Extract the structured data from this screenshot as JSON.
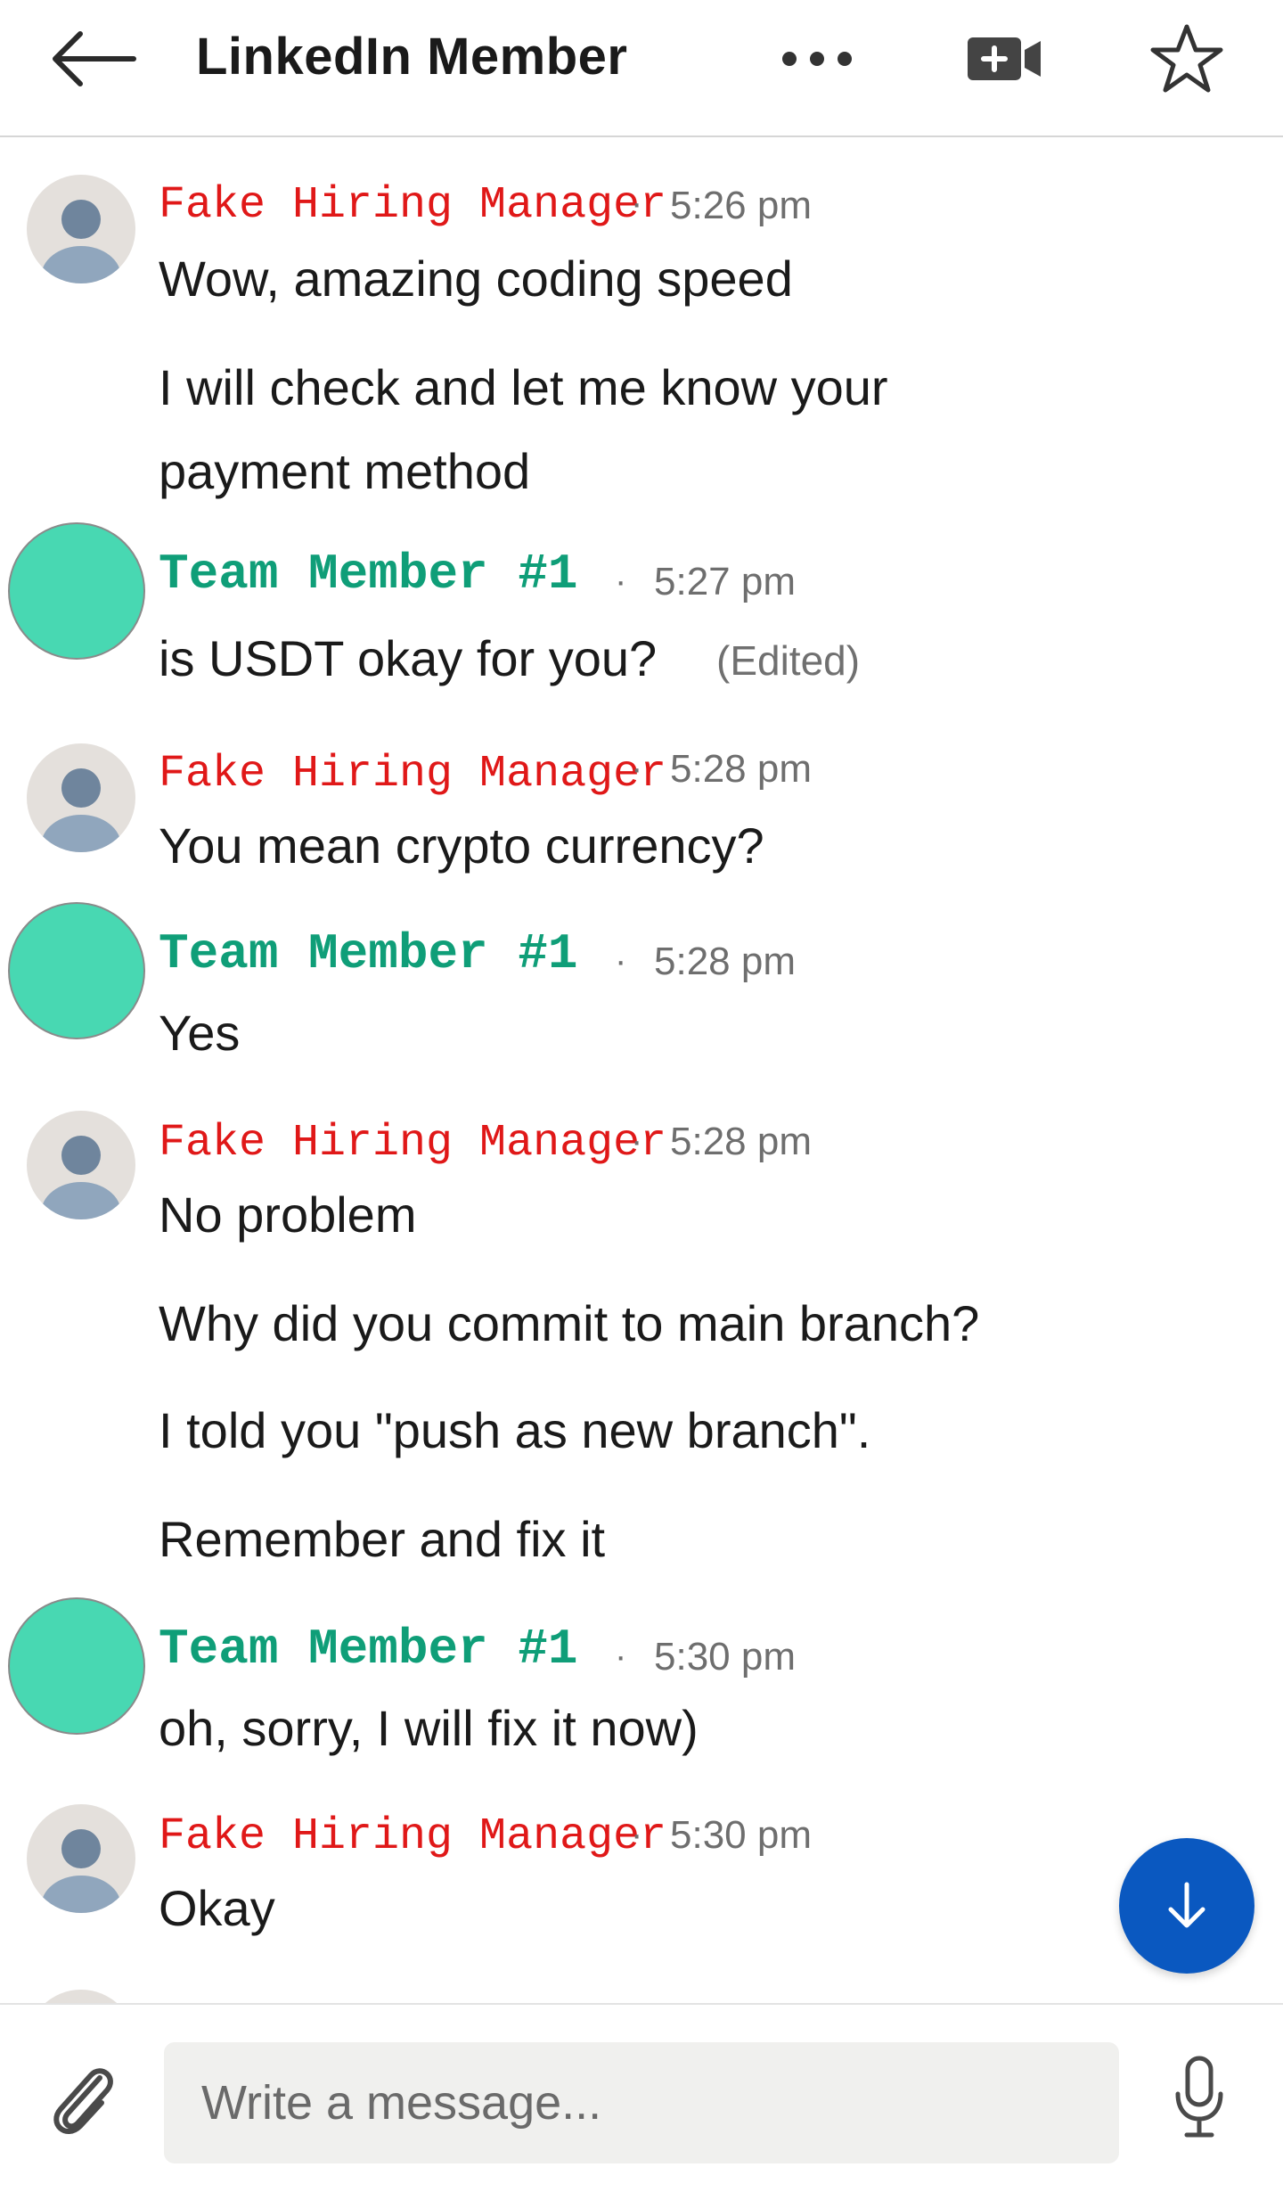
{
  "header": {
    "title": "LinkedIn Member",
    "icons": [
      "back-arrow-icon",
      "more-dots-icon",
      "video-call-icon",
      "star-icon"
    ]
  },
  "messages": [
    {
      "sender": "Fake Hiring Manager",
      "sender_color": "#e01818",
      "time": "5:26 pm",
      "lines": [
        "Wow, amazing coding speed",
        "I will check and let me know your",
        "payment method"
      ]
    },
    {
      "sender": "Team Member #1",
      "sender_color": "#0f9e78",
      "time": "5:27 pm",
      "lines": [
        "is USDT okay for you?"
      ],
      "edited": "(Edited)"
    },
    {
      "sender": "Fake Hiring Manager",
      "sender_color": "#e01818",
      "time": "5:28 pm",
      "lines": [
        "You mean crypto currency?"
      ]
    },
    {
      "sender": "Team Member #1",
      "sender_color": "#0f9e78",
      "time": "5:28 pm",
      "lines": [
        "Yes"
      ]
    },
    {
      "sender": "Fake Hiring Manager",
      "sender_color": "#e01818",
      "time": "5:28 pm",
      "lines": [
        "No problem",
        "Why did you commit to main branch?",
        "I told you \"push as new branch\".",
        "Remember and fix it"
      ]
    },
    {
      "sender": "Team Member #1",
      "sender_color": "#0f9e78",
      "time": "5:30 pm",
      "lines": [
        "oh, sorry, I will fix it now)"
      ]
    },
    {
      "sender": "Fake Hiring Manager",
      "sender_color": "#e01818",
      "time": "5:30 pm",
      "lines": [
        "Okay"
      ]
    }
  ],
  "separator": "·",
  "composer": {
    "placeholder": "Write a message...",
    "icons": [
      "paperclip-icon",
      "microphone-icon"
    ]
  },
  "scroll_button_icon": "arrow-down-icon",
  "colors": {
    "accent": "#0a58c0",
    "teal_avatar": "#48d8b2"
  }
}
